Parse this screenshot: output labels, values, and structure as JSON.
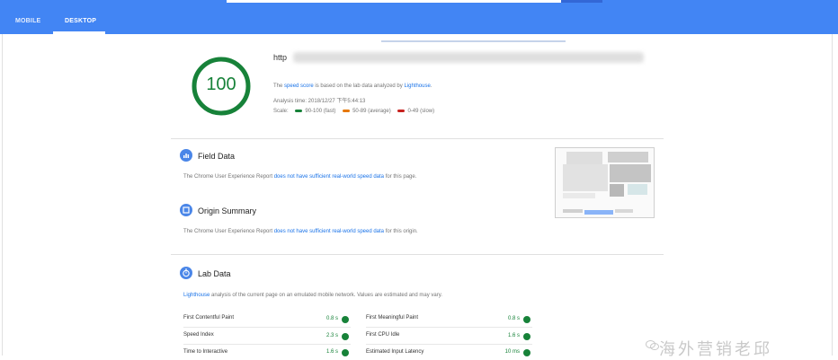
{
  "tabs": [
    {
      "label": "MOBILE",
      "active": false
    },
    {
      "label": "DESKTOP",
      "active": true
    }
  ],
  "summary": {
    "score": "100",
    "score_fraction": 1.0,
    "url": "http",
    "speed_note": {
      "prefix": "The ",
      "speed_link": "speed score",
      "middle": " is based on the lab data analyzed by ",
      "lighthouse_link": "Lighthouse",
      "suffix": "."
    },
    "analysis_time": "Analysis time: 2018/12/27 下午5:44:13",
    "scale": {
      "label": "Scale:",
      "fast": "90-100 (fast)",
      "average": "50-89 (average)",
      "slow": "0-49 (slow)"
    }
  },
  "colors": {
    "header": "#4285f4",
    "fast": "#178239",
    "average": "#e67700",
    "slow": "#c7221f",
    "link": "#1a73e8"
  },
  "field_data": {
    "title": "Field Data",
    "note_prefix": "The Chrome User Experience Report ",
    "note_link": "does not have sufficient real-world speed data",
    "note_suffix": " for this page."
  },
  "origin_summary": {
    "title": "Origin Summary",
    "note_prefix": "The Chrome User Experience Report ",
    "note_link": "does not have sufficient real-world speed data",
    "note_suffix": " for this origin."
  },
  "lab_data": {
    "title": "Lab Data",
    "note_link": "Lighthouse",
    "note_text": " analysis of the current page on an emulated mobile network. Values are estimated and may vary."
  },
  "metrics": [
    {
      "label": "First Contentful Paint",
      "value": "0.8 s"
    },
    {
      "label": "First Meaningful Paint",
      "value": "0.8 s"
    },
    {
      "label": "Speed Index",
      "value": "2.3 s"
    },
    {
      "label": "First CPU Idle",
      "value": "1.6 s"
    },
    {
      "label": "Time to Interactive",
      "value": "1.6 s"
    },
    {
      "label": "Estimated Input Latency",
      "value": "10 ms"
    }
  ],
  "watermark": "海外营销老邱"
}
